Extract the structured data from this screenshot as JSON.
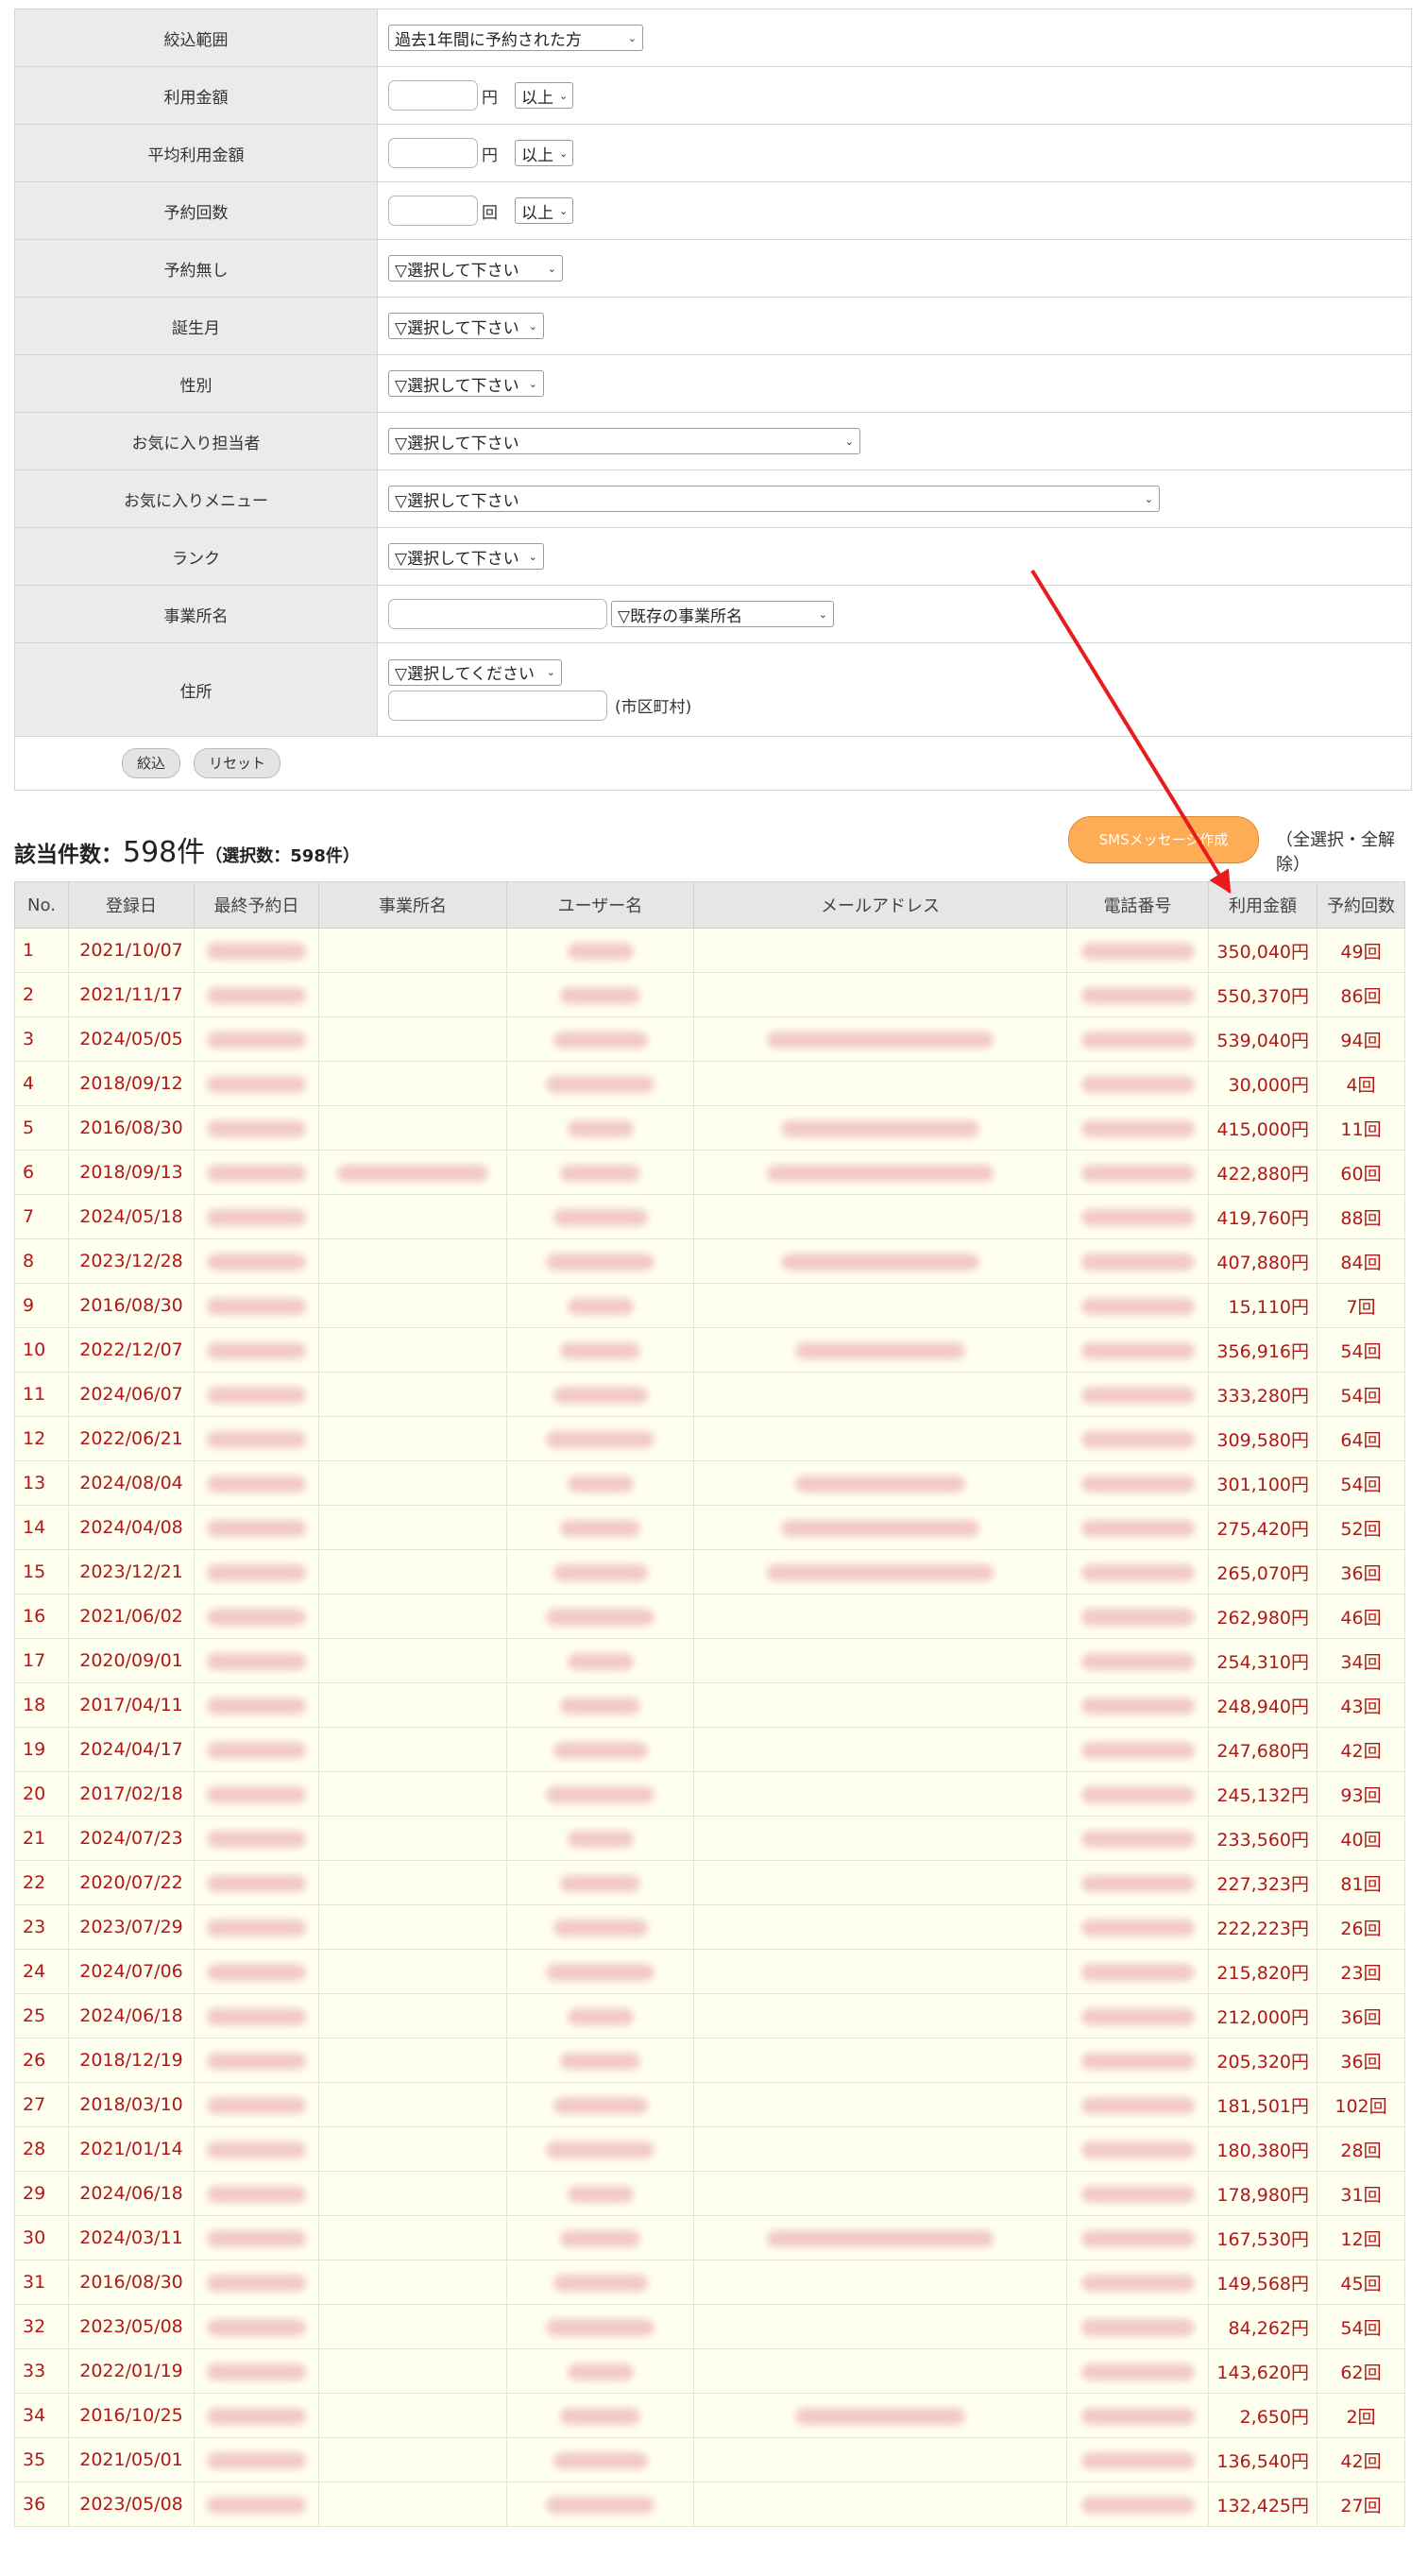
{
  "filter": {
    "rows": [
      {
        "label": "絞込範囲",
        "select": "過去1年間に予約された方",
        "sel_w": 270
      },
      {
        "label": "利用金額",
        "unit": "円",
        "select": "以上",
        "sel_w": 62
      },
      {
        "label": "平均利用金額",
        "unit": "円",
        "select": "以上",
        "sel_w": 62
      },
      {
        "label": "予約回数",
        "unit": "回",
        "select": "以上",
        "sel_w": 62
      },
      {
        "label": "予約無し",
        "select": "▽選択して下さい",
        "sel_w": 185
      },
      {
        "label": "誕生月",
        "select": "▽選択して下さい",
        "sel_w": 165
      },
      {
        "label": "性別",
        "select": "▽選択して下さい",
        "sel_w": 165
      },
      {
        "label": "お気に入り担当者",
        "select": "▽選択して下さい",
        "sel_w": 500
      },
      {
        "label": "お気に入りメニュー",
        "select": "▽選択して下さい",
        "sel_w": 817
      },
      {
        "label": "ランク",
        "select": "▽選択して下さい",
        "sel_w": 165
      }
    ],
    "office": {
      "label": "事業所名",
      "select": "▽既存の事業所名"
    },
    "address": {
      "label": "住所",
      "select": "▽選択してください",
      "city_note": "(市区町村)"
    },
    "buttons": {
      "narrow": "絞込",
      "reset": "リセット"
    }
  },
  "result": {
    "prefix": "該当件数：",
    "count": "598件",
    "selected": "（選択数：598件）",
    "sms_button": "SMSメッセージ作成",
    "select_all": "（全選択・全解除）"
  },
  "table": {
    "headers": [
      "No.",
      "登録日",
      "最終予約日",
      "事業所名",
      "ユーザー名",
      "メールアドレス",
      "電話番号",
      "利用金額",
      "予約回数"
    ],
    "rows": [
      {
        "no": "1",
        "reg": "2021/10/07",
        "amount": "350,040円",
        "count": "49回",
        "office": false,
        "mail": false
      },
      {
        "no": "2",
        "reg": "2021/11/17",
        "amount": "550,370円",
        "count": "86回",
        "office": false,
        "mail": false
      },
      {
        "no": "3",
        "reg": "2024/05/05",
        "amount": "539,040円",
        "count": "94回",
        "office": false,
        "mail": true
      },
      {
        "no": "4",
        "reg": "2018/09/12",
        "amount": "30,000円",
        "count": "4回",
        "office": false,
        "mail": false
      },
      {
        "no": "5",
        "reg": "2016/08/30",
        "amount": "415,000円",
        "count": "11回",
        "office": false,
        "mail": true
      },
      {
        "no": "6",
        "reg": "2018/09/13",
        "amount": "422,880円",
        "count": "60回",
        "office": true,
        "mail": true
      },
      {
        "no": "7",
        "reg": "2024/05/18",
        "amount": "419,760円",
        "count": "88回",
        "office": false,
        "mail": false
      },
      {
        "no": "8",
        "reg": "2023/12/28",
        "amount": "407,880円",
        "count": "84回",
        "office": false,
        "mail": true
      },
      {
        "no": "9",
        "reg": "2016/08/30",
        "amount": "15,110円",
        "count": "7回",
        "office": false,
        "mail": false
      },
      {
        "no": "10",
        "reg": "2022/12/07",
        "amount": "356,916円",
        "count": "54回",
        "office": false,
        "mail": true
      },
      {
        "no": "11",
        "reg": "2024/06/07",
        "amount": "333,280円",
        "count": "54回",
        "office": false,
        "mail": false
      },
      {
        "no": "12",
        "reg": "2022/06/21",
        "amount": "309,580円",
        "count": "64回",
        "office": false,
        "mail": false
      },
      {
        "no": "13",
        "reg": "2024/08/04",
        "amount": "301,100円",
        "count": "54回",
        "office": false,
        "mail": true
      },
      {
        "no": "14",
        "reg": "2024/04/08",
        "amount": "275,420円",
        "count": "52回",
        "office": false,
        "mail": true
      },
      {
        "no": "15",
        "reg": "2023/12/21",
        "amount": "265,070円",
        "count": "36回",
        "office": false,
        "mail": true
      },
      {
        "no": "16",
        "reg": "2021/06/02",
        "amount": "262,980円",
        "count": "46回",
        "office": false,
        "mail": false
      },
      {
        "no": "17",
        "reg": "2020/09/01",
        "amount": "254,310円",
        "count": "34回",
        "office": false,
        "mail": false
      },
      {
        "no": "18",
        "reg": "2017/04/11",
        "amount": "248,940円",
        "count": "43回",
        "office": false,
        "mail": false
      },
      {
        "no": "19",
        "reg": "2024/04/17",
        "amount": "247,680円",
        "count": "42回",
        "office": false,
        "mail": false
      },
      {
        "no": "20",
        "reg": "2017/02/18",
        "amount": "245,132円",
        "count": "93回",
        "office": false,
        "mail": false
      },
      {
        "no": "21",
        "reg": "2024/07/23",
        "amount": "233,560円",
        "count": "40回",
        "office": false,
        "mail": false
      },
      {
        "no": "22",
        "reg": "2020/07/22",
        "amount": "227,323円",
        "count": "81回",
        "office": false,
        "mail": false
      },
      {
        "no": "23",
        "reg": "2023/07/29",
        "amount": "222,223円",
        "count": "26回",
        "office": false,
        "mail": false
      },
      {
        "no": "24",
        "reg": "2024/07/06",
        "amount": "215,820円",
        "count": "23回",
        "office": false,
        "mail": false
      },
      {
        "no": "25",
        "reg": "2024/06/18",
        "amount": "212,000円",
        "count": "36回",
        "office": false,
        "mail": false
      },
      {
        "no": "26",
        "reg": "2018/12/19",
        "amount": "205,320円",
        "count": "36回",
        "office": false,
        "mail": false
      },
      {
        "no": "27",
        "reg": "2018/03/10",
        "amount": "181,501円",
        "count": "102回",
        "office": false,
        "mail": false
      },
      {
        "no": "28",
        "reg": "2021/01/14",
        "amount": "180,380円",
        "count": "28回",
        "office": false,
        "mail": false
      },
      {
        "no": "29",
        "reg": "2024/06/18",
        "amount": "178,980円",
        "count": "31回",
        "office": false,
        "mail": false
      },
      {
        "no": "30",
        "reg": "2024/03/11",
        "amount": "167,530円",
        "count": "12回",
        "office": false,
        "mail": true
      },
      {
        "no": "31",
        "reg": "2016/08/30",
        "amount": "149,568円",
        "count": "45回",
        "office": false,
        "mail": false
      },
      {
        "no": "32",
        "reg": "2023/05/08",
        "amount": "84,262円",
        "count": "54回",
        "office": false,
        "mail": false
      },
      {
        "no": "33",
        "reg": "2022/01/19",
        "amount": "143,620円",
        "count": "62回",
        "office": false,
        "mail": false
      },
      {
        "no": "34",
        "reg": "2016/10/25",
        "amount": "2,650円",
        "count": "2回",
        "office": false,
        "mail": true
      },
      {
        "no": "35",
        "reg": "2021/05/01",
        "amount": "136,540円",
        "count": "42回",
        "office": false,
        "mail": false
      },
      {
        "no": "36",
        "reg": "2023/05/08",
        "amount": "132,425円",
        "count": "27回",
        "office": false,
        "mail": false
      }
    ]
  },
  "annotation": {
    "color": "#e81c1c"
  }
}
